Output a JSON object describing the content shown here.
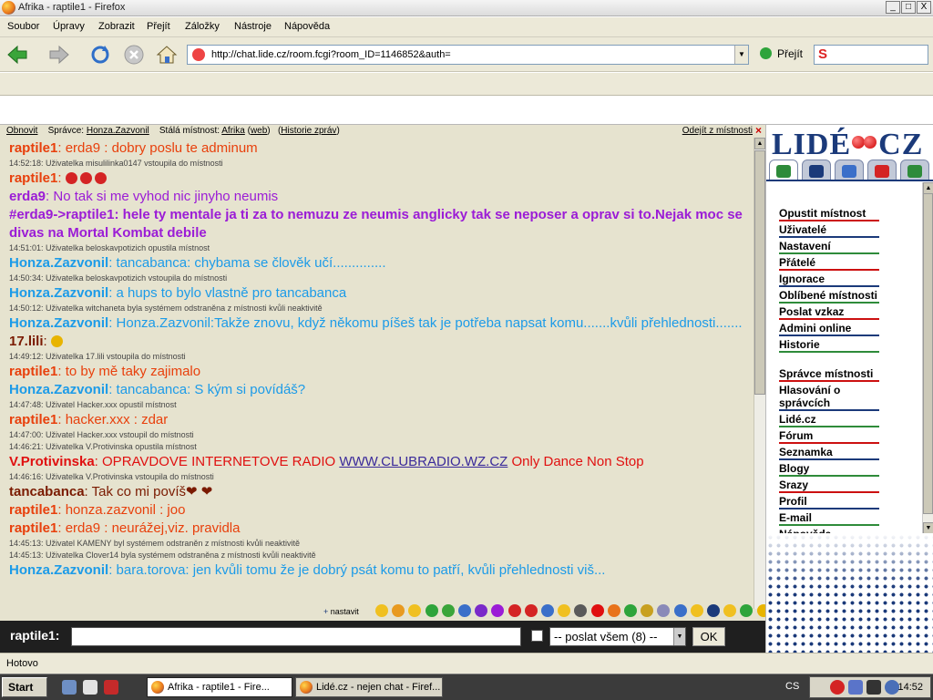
{
  "window": {
    "title": "Afrika - raptile1 - Firefox",
    "controls": [
      "_",
      "□",
      "X"
    ]
  },
  "menu": [
    "Soubor",
    "Úpravy",
    "Zobrazit",
    "Přejít",
    "Záložky",
    "Nástroje",
    "Nápověda"
  ],
  "nav": {
    "url": "http://chat.lide.cz/room.fcgi?room_ID=1146852&auth=",
    "go_label": "Přejít",
    "search_logo": "S"
  },
  "info": {
    "refresh": "Obnovit",
    "admin_label": "Správce:",
    "admin": "Honza.Zazvonil",
    "room_label": "Stálá místnost:",
    "room": "Afrika",
    "web": "web",
    "history": "Historie zpráv",
    "leave": "Odejít z místnosti"
  },
  "messages": [
    {
      "kind": "msg",
      "nick": "raptile1",
      "sep": ": ",
      "text": "erda9 : dobry poslu te adminum",
      "color": "#e8400c",
      "bold": false,
      "smileys": 0
    },
    {
      "kind": "sys",
      "text": "14:52:18: Uživatelka misulilinka0147 vstoupila do místnosti"
    },
    {
      "kind": "msg",
      "nick": "raptile1",
      "sep": ": ",
      "text": "",
      "color": "#e8400c",
      "bold": false,
      "smileys": 3
    },
    {
      "kind": "msg",
      "nick": "erda9",
      "sep": ": ",
      "text": "No tak si me vyhod nic jinyho neumis",
      "color": "#9b1cd6",
      "bold": false,
      "smileys": 0
    },
    {
      "kind": "msg",
      "nick": "#erda9->raptile1",
      "sep": ": ",
      "text": "hele ty mentale ja ti za to nemuzu ze neumis anglicky tak se neposer a oprav si to.Nejak moc se divas na Mortal Kombat debile",
      "color": "#9b1cd6",
      "bold": true,
      "smileys": 0
    },
    {
      "kind": "sys",
      "text": "14:51:01: Uživatelka beloskavpotizich opustila místnost"
    },
    {
      "kind": "msg",
      "nick": "Honza.Zazvonil",
      "sep": ": ",
      "text": "tancabanca: chybama se člověk učí..............",
      "color": "#1c9be8",
      "bold": false,
      "smileys": 0
    },
    {
      "kind": "sys",
      "text": "14:50:34: Uživatelka beloskavpotizich vstoupila do místnosti"
    },
    {
      "kind": "msg",
      "nick": "Honza.Zazvonil",
      "sep": ": ",
      "text": "a hups to bylo vlastně pro tancabanca",
      "color": "#1c9be8",
      "bold": false,
      "smileys": 0
    },
    {
      "kind": "sys",
      "text": "14:50:12: Uživatelka witchaneta byla systémem odstraněna z místnosti kvůli neaktivitě"
    },
    {
      "kind": "msg",
      "nick": "Honza.Zazvonil",
      "sep": ": ",
      "text": "Honza.Zazvonil:Takže znovu, když někomu píšeš tak je potřeba napsat komu.......kvůli přehlednosti.......",
      "color": "#1c9be8",
      "bold": false,
      "smileys": 0
    },
    {
      "kind": "msg",
      "nick": "17.lili",
      "sep": ": ",
      "text": "",
      "color": "#7a1a00",
      "bold": false,
      "smileys": 1
    },
    {
      "kind": "sys",
      "text": "14:49:12: Uživatelka 17.lili vstoupila do místnosti"
    },
    {
      "kind": "msg",
      "nick": "raptile1",
      "sep": ": ",
      "text": "to by mě taky zajimalo",
      "color": "#e8400c",
      "bold": false,
      "smileys": 0
    },
    {
      "kind": "msg",
      "nick": "Honza.Zazvonil",
      "sep": ": ",
      "text": "tancabanca: S kým si povídáš?",
      "color": "#1c9be8",
      "bold": false,
      "smileys": 0
    },
    {
      "kind": "sys",
      "text": "14:47:48: Uživatel Hacker.xxx opustil místnost"
    },
    {
      "kind": "msg",
      "nick": "raptile1",
      "sep": ": ",
      "text": "hacker.xxx : zdar",
      "color": "#e8400c",
      "bold": false,
      "smileys": 0
    },
    {
      "kind": "sys",
      "text": "14:47:00: Uživatel Hacker.xxx vstoupil do místnosti"
    },
    {
      "kind": "sys",
      "text": "14:46:21: Uživatelka V.Protivinska opustila místnost"
    },
    {
      "kind": "msg",
      "nick": "V.Protivinska",
      "sep": ": ",
      "text": "OPRAVDOVE INTERNETOVE RADIO ",
      "link": "WWW.CLUBRADIO.WZ.CZ",
      "after": " Only Dance Non Stop",
      "color": "#e01010",
      "bold": false,
      "smileys": 0
    },
    {
      "kind": "sys",
      "text": "14:46:16: Uživatelka V.Protivinska vstoupila do místnosti"
    },
    {
      "kind": "msg",
      "nick": "tancabanca",
      "sep": ": ",
      "text": "Tak co mi povíš❤ ❤",
      "color": "#7a1a00",
      "bold": false,
      "smileys": 0
    },
    {
      "kind": "msg",
      "nick": "raptile1",
      "sep": ": ",
      "text": "honza.zazvonil : joo",
      "color": "#e8400c",
      "bold": false,
      "smileys": 0
    },
    {
      "kind": "msg",
      "nick": "raptile1",
      "sep": ": ",
      "text": "erda9 : neurážej,viz. pravidla",
      "color": "#e8400c",
      "bold": false,
      "smileys": 0
    },
    {
      "kind": "sys",
      "text": "14:45:13: Uživatel KAMENY byl systémem odstraněn z místnosti kvůli neaktivitě"
    },
    {
      "kind": "sys",
      "text": "14:45:13: Uživatelka Clover14 byla systémem odstraněna z místnosti kvůli neaktivitě"
    },
    {
      "kind": "msg",
      "nick": "Honza.Zazvonil",
      "sep": ": ",
      "text": "bara.torova: jen kvůli tomu že je dobrý psát komu to patří, kvůli přehlednosti viš...",
      "color": "#1c9be8",
      "bold": false,
      "smileys": 0
    }
  ],
  "emoticons": {
    "add": "+",
    "label": "nastavit",
    "count": 25
  },
  "input": {
    "nick": "raptile1:",
    "value": "",
    "send_to": "-- poslat všem (8) --",
    "ok": "OK"
  },
  "sidebar": {
    "logo": "LIDÉ CZ",
    "menu": [
      {
        "label": "Opustit místnost",
        "color": "#cc1010"
      },
      {
        "label": "Uživatelé",
        "color": "#1b3a7a"
      },
      {
        "label": "Nastavení",
        "color": "#2e8b3a"
      },
      {
        "label": "Přátelé",
        "color": "#cc1010"
      },
      {
        "label": "Ignorace",
        "color": "#1b3a7a"
      },
      {
        "label": "Oblíbené místnosti",
        "color": "#2e8b3a"
      },
      {
        "label": "Poslat vzkaz",
        "color": "#cc1010"
      },
      {
        "label": "Admini online",
        "color": "#1b3a7a"
      },
      {
        "label": "Historie",
        "color": "#2e8b3a"
      },
      {
        "label": "Správce místnosti",
        "color": "#cc1010"
      },
      {
        "label": "Hlasování o správcích",
        "color": "#1b3a7a"
      },
      {
        "label": "Lidé.cz",
        "color": "#2e8b3a"
      },
      {
        "label": "Fórum",
        "color": "#cc1010"
      },
      {
        "label": "Seznamka",
        "color": "#1b3a7a"
      },
      {
        "label": "Blogy",
        "color": "#2e8b3a"
      },
      {
        "label": "Srazy",
        "color": "#cc1010"
      },
      {
        "label": "Profil",
        "color": "#1b3a7a"
      },
      {
        "label": "E-mail",
        "color": "#2e8b3a"
      },
      {
        "label": "Nápověda",
        "color": "#cc1010"
      }
    ]
  },
  "status": "Hotovo",
  "taskbar": {
    "start": "Start",
    "tasks": [
      "Afrika - raptile1 - Fire...",
      "Lidé.cz - nejen chat - Firef..."
    ],
    "lang": "CS",
    "clock": "14:52"
  }
}
